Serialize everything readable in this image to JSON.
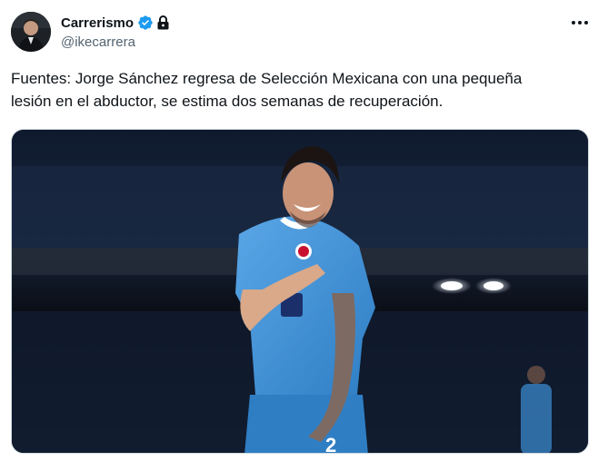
{
  "author": {
    "display_name": "Carrerismo",
    "handle": "@ikecarrera",
    "verified_icon": "verified-badge-icon",
    "protected_icon": "lock-icon"
  },
  "menu": {
    "icon": "more-options-icon"
  },
  "tweet": {
    "text": "Fuentes: Jorge Sánchez regresa de Selección Mexicana con una pequeña\nlesión en el abductor, se estima dos semanas de recuperación."
  },
  "media": {
    "description_icon": "photo",
    "jersey_number": "2"
  },
  "colors": {
    "verified": "#1d9bf0",
    "text_primary": "#0f1419",
    "text_secondary": "#536471",
    "jersey": "#3d8fd6"
  }
}
